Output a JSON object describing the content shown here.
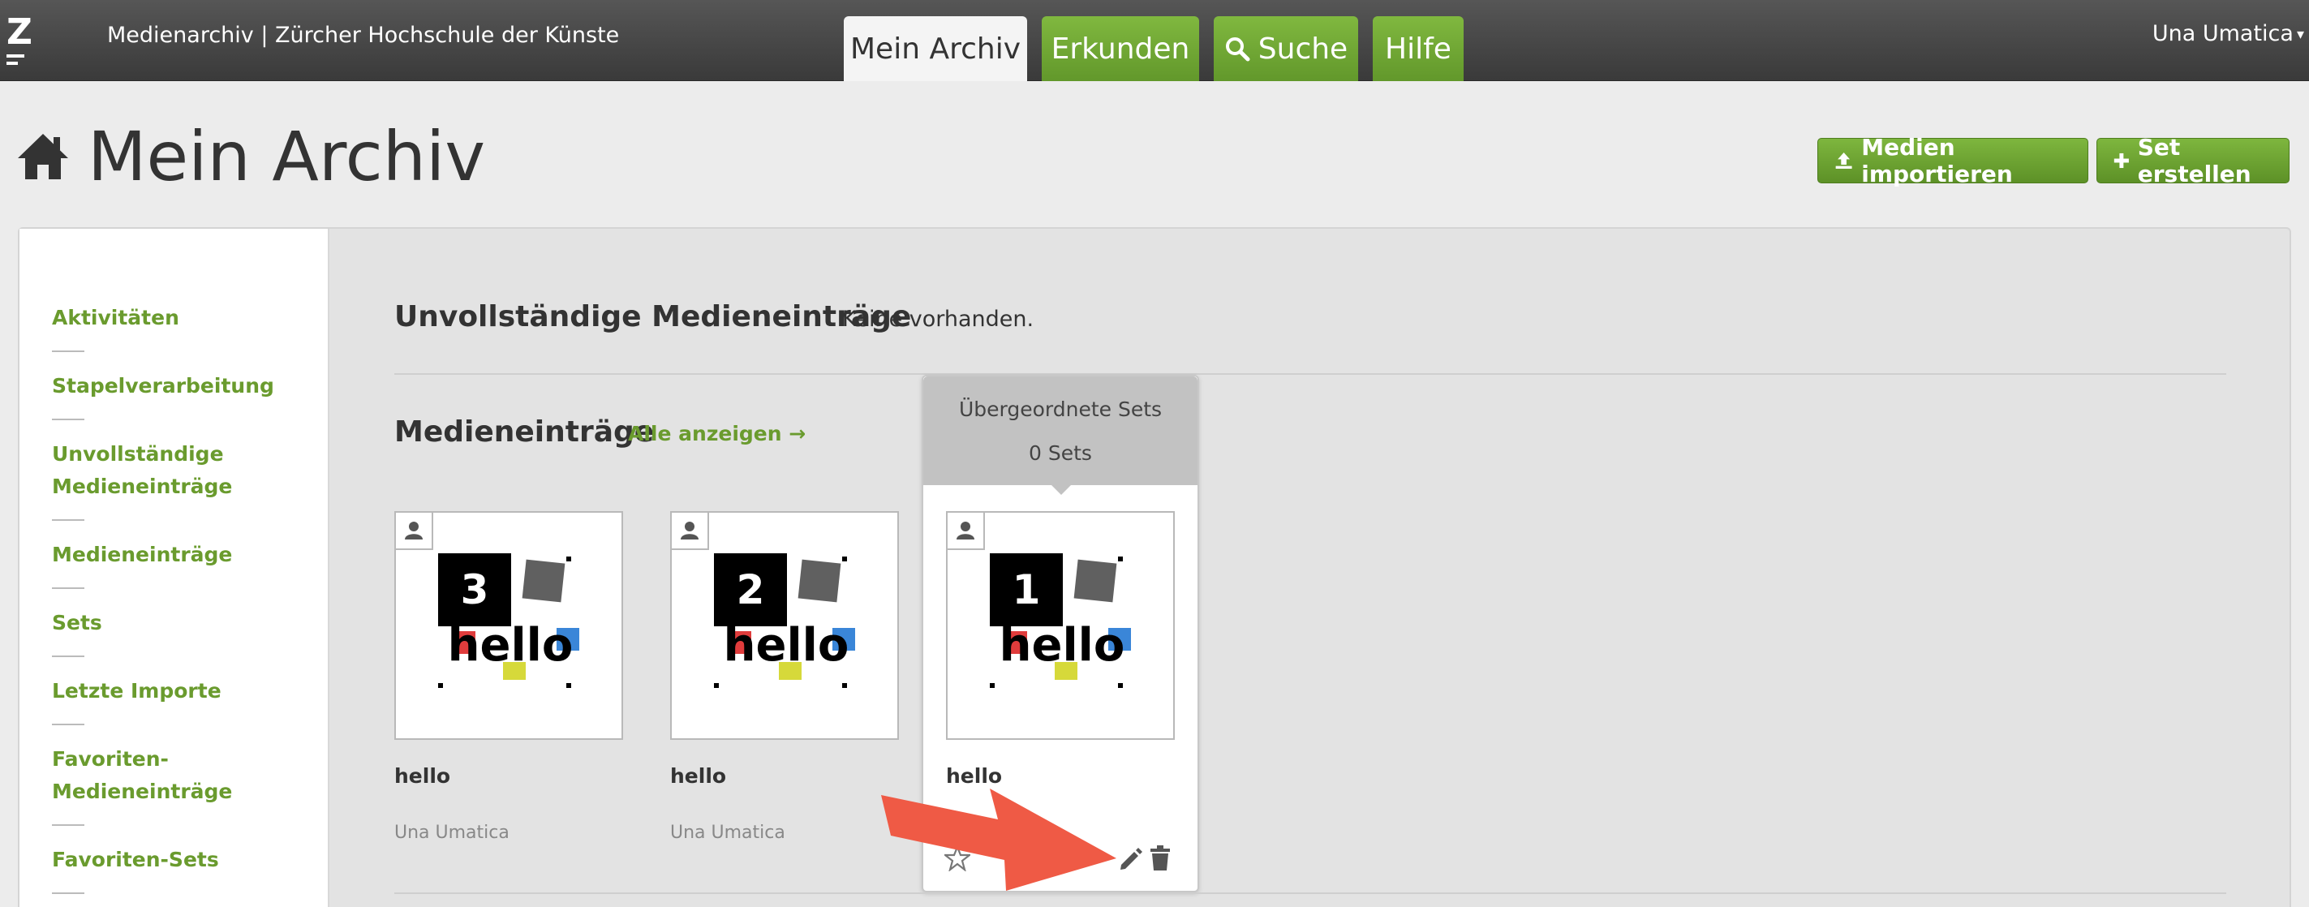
{
  "topbar": {
    "logo_letter": "Z",
    "app_title": "Medienarchiv | Zürcher Hochschule der Künste",
    "tabs": [
      {
        "label": "Mein Archiv",
        "active": true
      },
      {
        "label": "Erkunden",
        "active": false
      },
      {
        "label": "Suche",
        "active": false,
        "icon": "search-icon"
      },
      {
        "label": "Hilfe",
        "active": false
      }
    ],
    "user_name": "Una Umatica",
    "user_caret": "▾"
  },
  "page": {
    "title": "Mein Archiv",
    "title_icon": "home-icon",
    "import_button": "Medien importieren",
    "create_set_button": "Set erstellen"
  },
  "sidebar": {
    "items": [
      {
        "label": "Aktivitäten"
      },
      {
        "label": "Stapelverarbeitung"
      },
      {
        "label_line1": "Unvollständige",
        "label_line2": "Medieneinträge"
      },
      {
        "label": "Medieneinträge"
      },
      {
        "label": "Sets"
      },
      {
        "label": "Letzte Importe"
      },
      {
        "label_line1": "Favoriten-",
        "label_line2": "Medieneinträge"
      },
      {
        "label": "Favoriten-Sets"
      }
    ]
  },
  "incomplete": {
    "title": "Unvollständige Medieneinträge",
    "note": "Keine vorhanden."
  },
  "media": {
    "title": "Medieneinträge",
    "show_all": "Alle anzeigen →",
    "cards": [
      {
        "number": "3",
        "image_text": "hello",
        "title": "hello",
        "author": "Una Umatica"
      },
      {
        "number": "2",
        "image_text": "hello",
        "title": "hello",
        "author": "Una Umatica"
      },
      {
        "number": "1",
        "image_text": "hello",
        "title": "hello",
        "author": ""
      }
    ]
  },
  "hover_card": {
    "header_label": "Übergeordnete Sets",
    "sets_count": "0 Sets"
  },
  "colors": {
    "green": "#6a9b2e",
    "annotation_arrow": "#ef5a45"
  }
}
